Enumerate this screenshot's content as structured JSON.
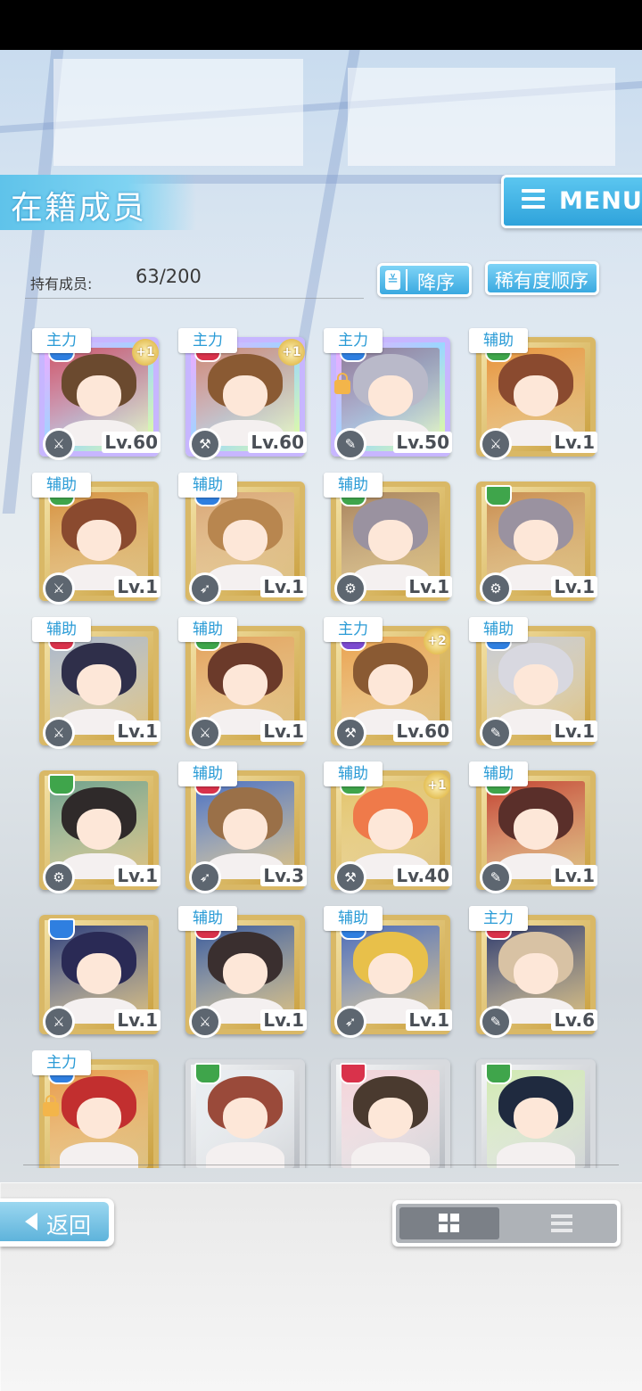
{
  "header": {
    "title": "在籍成员",
    "menu_label": "MENU"
  },
  "members_count": {
    "label": "持有成员:",
    "value": "63/200"
  },
  "sort": {
    "order_label": "降序",
    "order_icon": "chevron-down-double",
    "rarity_label": "稀有度顺序"
  },
  "members": [
    {
      "role": "主力",
      "level": "Lv.60",
      "plus": "+1",
      "rarity": "rainbow",
      "attr": "#2f7fe0",
      "skill": "sword",
      "hair": "#6b4a2f",
      "bg": "#c95b6a",
      "locked": false
    },
    {
      "role": "主力",
      "level": "Lv.60",
      "plus": "+1",
      "rarity": "rainbow",
      "attr": "#d9324b",
      "skill": "hammer",
      "hair": "#8a5a33",
      "bg": "#c98e78",
      "locked": false
    },
    {
      "role": "主力",
      "level": "Lv.50",
      "plus": "",
      "rarity": "rainbow",
      "attr": "#2f7fe0",
      "skill": "staff",
      "hair": "#b9b9c9",
      "bg": "#8a7f99",
      "locked": true
    },
    {
      "role": "辅助",
      "level": "Lv.1",
      "plus": "",
      "rarity": "gold",
      "attr": "#3fa54b",
      "skill": "sword",
      "hair": "#8a4a2f",
      "bg": "#e6923a",
      "locked": false
    },
    {
      "role": "辅助",
      "level": "Lv.1",
      "plus": "",
      "rarity": "gold",
      "attr": "#3fa54b",
      "skill": "sword",
      "hair": "#8a4a2f",
      "bg": "#d5913f",
      "locked": false
    },
    {
      "role": "辅助",
      "level": "Lv.1",
      "plus": "",
      "rarity": "gold",
      "attr": "#2f7fe0",
      "skill": "spear",
      "hair": "#b8864f",
      "bg": "#d9a676",
      "locked": false
    },
    {
      "role": "辅助",
      "level": "Lv.1",
      "plus": "",
      "rarity": "gold",
      "attr": "#3fa54b",
      "skill": "gear",
      "hair": "#9a92a0",
      "bg": "#a8825a",
      "locked": false
    },
    {
      "role": "",
      "level": "Lv.1",
      "plus": "",
      "rarity": "gold",
      "attr": "#3fa54b",
      "skill": "gear",
      "hair": "#9a92a0",
      "bg": "#c88c4e",
      "locked": false
    },
    {
      "role": "辅助",
      "level": "Lv.1",
      "plus": "",
      "rarity": "gold",
      "attr": "#d9324b",
      "skill": "sword",
      "hair": "#2f2f4a",
      "bg": "#aab6c8",
      "locked": false
    },
    {
      "role": "辅助",
      "level": "Lv.1",
      "plus": "",
      "rarity": "gold",
      "attr": "#3fa54b",
      "skill": "sword",
      "hair": "#6b3a2a",
      "bg": "#e2a05a",
      "locked": false
    },
    {
      "role": "主力",
      "level": "Lv.60",
      "plus": "+2",
      "rarity": "gold",
      "attr": "#7b4ad0",
      "skill": "hammer",
      "hair": "#8a5a33",
      "bg": "#e9a14e",
      "locked": false
    },
    {
      "role": "辅助",
      "level": "Lv.1",
      "plus": "",
      "rarity": "gold",
      "attr": "#2f7fe0",
      "skill": "staff",
      "hair": "#d8d8e0",
      "bg": "#c7c9cf",
      "locked": false
    },
    {
      "role": "",
      "level": "Lv.1",
      "plus": "",
      "rarity": "gold",
      "attr": "#3fa54b",
      "skill": "gear",
      "hair": "#2f2a2a",
      "bg": "#6fa08a",
      "locked": false
    },
    {
      "role": "辅助",
      "level": "Lv.3",
      "plus": "",
      "rarity": "gold",
      "attr": "#d9324b",
      "skill": "spear",
      "hair": "#9a7048",
      "bg": "#4a6fc0",
      "locked": false
    },
    {
      "role": "辅助",
      "level": "Lv.40",
      "plus": "+1",
      "rarity": "gold",
      "attr": "#3fa54b",
      "skill": "hammer",
      "hair": "#ef7a4a",
      "bg": "#e2c36a",
      "locked": false
    },
    {
      "role": "辅助",
      "level": "Lv.1",
      "plus": "",
      "rarity": "gold",
      "attr": "#3fa54b",
      "skill": "staff",
      "hair": "#5a2f2a",
      "bg": "#c2432f",
      "locked": false
    },
    {
      "role": "",
      "level": "Lv.1",
      "plus": "",
      "rarity": "gold",
      "attr": "#2f7fe0",
      "skill": "sword",
      "hair": "#2a2a55",
      "bg": "#2f3f7a",
      "locked": false
    },
    {
      "role": "辅助",
      "level": "Lv.1",
      "plus": "",
      "rarity": "gold",
      "attr": "#d9324b",
      "skill": "sword",
      "hair": "#3a2f2f",
      "bg": "#3a5a9a",
      "locked": false
    },
    {
      "role": "辅助",
      "level": "Lv.1",
      "plus": "",
      "rarity": "gold",
      "attr": "#2f7fe0",
      "skill": "spear",
      "hair": "#e8c04a",
      "bg": "#4a6ab8",
      "locked": false
    },
    {
      "role": "主力",
      "level": "Lv.6",
      "plus": "",
      "rarity": "gold",
      "attr": "#d9324b",
      "skill": "staff",
      "hair": "#d8c2a4",
      "bg": "#2f3a6a",
      "locked": false
    },
    {
      "role": "主力",
      "level": "",
      "plus": "",
      "rarity": "gold",
      "attr": "#2f7fe0",
      "skill": "",
      "hair": "#c22f2f",
      "bg": "#e79a4a",
      "locked": true
    },
    {
      "role": "",
      "level": "",
      "plus": "",
      "rarity": "silver",
      "attr": "#3fa54b",
      "skill": "",
      "hair": "#9a4a3a",
      "bg": "#e7ecf0",
      "locked": false
    },
    {
      "role": "",
      "level": "",
      "plus": "",
      "rarity": "silver",
      "attr": "#d9324b",
      "skill": "",
      "hair": "#4a3a2f",
      "bg": "#f3d2d8",
      "locked": false
    },
    {
      "role": "",
      "level": "",
      "plus": "",
      "rarity": "silver",
      "attr": "#3fa54b",
      "skill": "",
      "hair": "#1f2a3f",
      "bg": "#cfe8b0",
      "locked": false
    }
  ],
  "footer": {
    "back_label": "返回",
    "view_grid_icon": "grid-icon",
    "view_list_icon": "list-icon"
  },
  "colors": {
    "accent": "#3aa9e0",
    "gold_frame": "#d9b866"
  }
}
